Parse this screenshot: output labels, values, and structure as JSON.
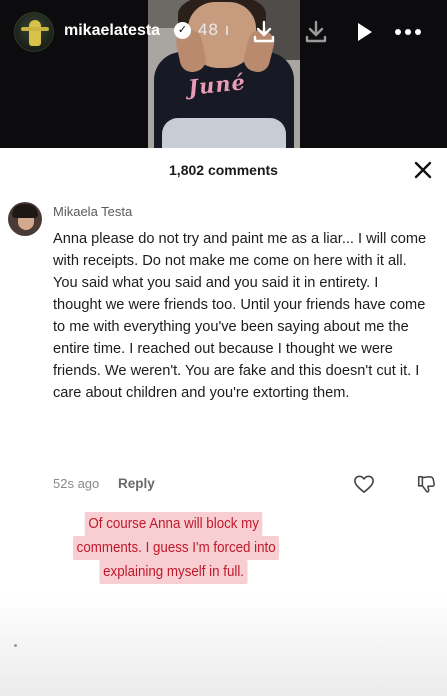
{
  "story": {
    "username": "mikaelatesta",
    "timestamp": "48 ı",
    "icons": {
      "avatar": "avatar-icon",
      "verified": "verified-badge-icon",
      "download": "download-icon",
      "play": "play-icon",
      "more": "more-icon"
    }
  },
  "comments_sheet": {
    "count_label": "1,802 comments",
    "close_icon": "close-icon",
    "comment": {
      "author": "Mikaela Testa",
      "body": "Anna please do not try and paint me as a liar... I will come with receipts. Do not make me come on here with it all. You said what you said and you said it in entirety. I thought we were friends too. Until your friends have come to me with everything you've been saying about me the entire time. I reached out because I thought we were friends. We weren't. You are fake and this doesn't cut it. I care about children and you're extorting them.",
      "time": "52s ago",
      "reply_label": "Reply",
      "like_icon": "heart-icon",
      "dislike_icon": "thumbs-down-icon"
    }
  },
  "caption": {
    "lines": [
      "Of course Anna will block my",
      "comments. I guess I'm forced into",
      "explaining myself in full."
    ],
    "text_color": "#c0182a",
    "highlight_color": "#f7cfd2"
  },
  "frame_text": "Juné"
}
